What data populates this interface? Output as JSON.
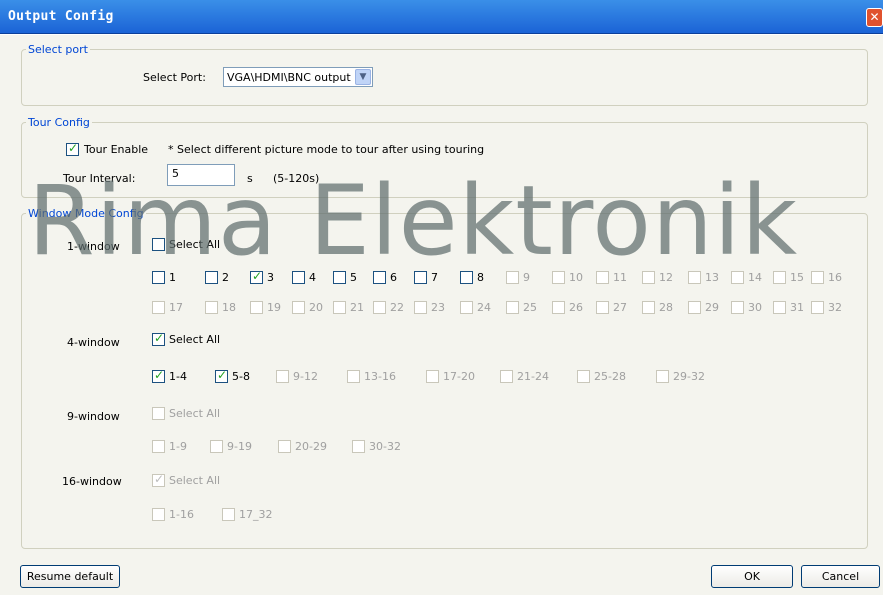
{
  "window": {
    "title": "Output Config",
    "close_glyph": "✕"
  },
  "select_port_group": {
    "legend": "Select port",
    "label": "Select Port:",
    "value": "VGA\\HDMI\\BNC output"
  },
  "tour_group": {
    "legend": "Tour Config",
    "tour_enable_label": "Tour Enable",
    "tour_enable_checked": true,
    "note": "* Select different picture mode to tour after using touring",
    "interval_label": "Tour Interval:",
    "interval_value": "5",
    "unit": "s",
    "range": "(5-120s)"
  },
  "window_mode_group": {
    "legend": "Window Mode Config",
    "one_window": {
      "label": "1-window",
      "select_all": "Select All",
      "row1": [
        "1",
        "2",
        "3",
        "4",
        "5",
        "6",
        "7",
        "8",
        "9",
        "10",
        "11",
        "12",
        "13",
        "14",
        "15",
        "16"
      ],
      "row2": [
        "17",
        "18",
        "19",
        "20",
        "21",
        "22",
        "23",
        "24",
        "25",
        "26",
        "27",
        "28",
        "29",
        "30",
        "31",
        "32"
      ]
    },
    "four_window": {
      "label": "4-window",
      "select_all": "Select All",
      "items": [
        "1-4",
        "5-8",
        "9-12",
        "13-16",
        "17-20",
        "21-24",
        "25-28",
        "29-32"
      ]
    },
    "nine_window": {
      "label": "9-window",
      "select_all": "Select All",
      "items": [
        "1-9",
        "9-19",
        "20-29",
        "30-32"
      ]
    },
    "sixteen_window": {
      "label": "16-window",
      "select_all": "Select All",
      "items": [
        "1-16",
        "17_32"
      ]
    }
  },
  "buttons": {
    "resume_default": "Resume default",
    "ok": "OK",
    "cancel": "Cancel"
  },
  "watermark": "Rima Elektronik"
}
